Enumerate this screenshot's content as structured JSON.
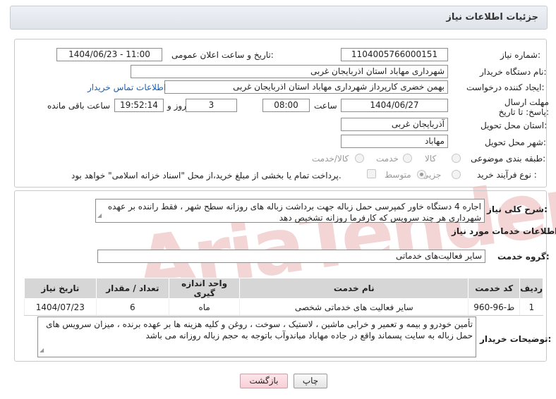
{
  "header": {
    "title": "جزئیات اطلاعات نیاز"
  },
  "form": {
    "need_number_label": "شماره نیاز:",
    "need_number": "1104005766000151",
    "announce_label": "تاریخ و ساعت اعلان عمومی:",
    "announce_value": "1404/06/23 - 11:00",
    "buyer_org_label": "نام دستگاه خریدار:",
    "buyer_org": "شهرداری مهاباد استان اذربایجان غربی",
    "creator_label": "ایجاد کننده درخواست:",
    "creator": "بهمن خضری کارپرداز شهرداری مهاباد استان اذربایجان غربی",
    "contact_link": "اطلاعات تماس خریدار",
    "deadline_label": "مهلت ارسال پاسخ: تا تاریخ:",
    "deadline_date": "1404/06/27",
    "time_label": "ساعت",
    "deadline_time": "08:00",
    "days": "3",
    "days_label": "روز و",
    "remaining_time": "19:52:14",
    "remaining_label": "ساعت باقی مانده",
    "province_label": "استان محل تحویل:",
    "province": "آذربایجان غربی",
    "city_label": "شهر محل تحویل:",
    "city": "مهاباد",
    "category_label": "طبقه بندی موضوعی:",
    "category_options": [
      "کالا",
      "خدمت",
      "کالا/خدمت"
    ],
    "process_label": "نوع فرآیند خرید :",
    "process_options": [
      "جزیی",
      "متوسط"
    ],
    "payment_note": "پرداخت تمام یا بخشی از مبلغ خرید،از محل \"اسناد خزانه اسلامی\" خواهد بود."
  },
  "need": {
    "summary_label": "شرح کلی نیاز:",
    "summary": "اجاره 4 دستگاه خاور کمپرسی حمل زباله جهت برداشت زباله های روزانه سطح شهر ، فقط راننده بر عهده شهرداری هر چند سرویس که کارفرما روزانه تشخیص دهد",
    "services_title": "اطلاعات خدمات مورد نیاز",
    "group_label": "گروه خدمت:",
    "group": "سایر فعالیت‌های خدماتی"
  },
  "table": {
    "headers": [
      "ردیف",
      "کد خدمت",
      "نام خدمت",
      "واحد اندازه گیری",
      "تعداد / مقدار",
      "تاریخ نیاز"
    ],
    "rows": [
      [
        "1",
        "ط-96-960",
        "سایر فعالیت های خدماتی شخصی",
        "ماه",
        "6",
        "1404/07/23"
      ]
    ]
  },
  "buyer_notes_label": "توضیحات خریدار:",
  "buyer_notes": "تأمین خودرو و بیمه و تعمیر و خرابی ماشین ، لاستیک ، سوخت ، روغن و کلیه هزینه ها بر عهده برنده ، میزان سرویس های حمل زباله به سایت پسماند واقع در جاده مهاباد میاندوآب باتوجه به حجم زباله روزانه می باشد",
  "buttons": {
    "print": "چاپ",
    "back": "بازگشت"
  },
  "watermark": "AriaTender.net"
}
